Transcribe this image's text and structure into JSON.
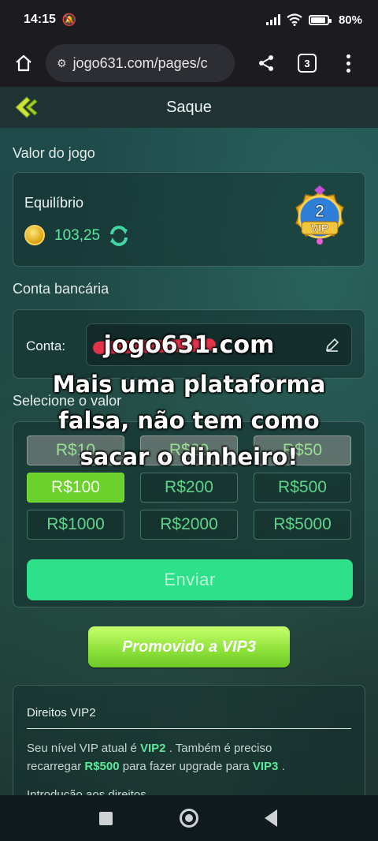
{
  "status_bar": {
    "time": "14:15",
    "battery": "80%"
  },
  "browser": {
    "url": "jogo631.com/pages/c",
    "tab_count": "3"
  },
  "header": {
    "title": "Saque"
  },
  "game_value": {
    "section_label": "Valor do jogo",
    "balance_label": "Equilíbrio",
    "balance_value": "103,25",
    "vip_level": "2",
    "vip_text": "VIP"
  },
  "bank": {
    "section_label": "Conta bancária",
    "field_label": "Conta:"
  },
  "amount": {
    "section_label": "Selecione o valor",
    "options": [
      "R$10",
      "R$20",
      "R$50",
      "R$100",
      "R$200",
      "R$500",
      "R$1000",
      "R$2000",
      "R$5000"
    ],
    "selected": "R$100",
    "submit_label": "Enviar"
  },
  "promo_button": "Promovido a VIP3",
  "rights": {
    "title": "Direitos VIP2",
    "text_1": "Seu nível VIP atual é",
    "current_vip": "VIP2",
    "text_2": ". Também é preciso",
    "text_3": "recarregar",
    "recharge_amount": "R$500",
    "text_4": "para fazer upgrade para",
    "next_vip": "VIP3",
    "text_5": ".",
    "intro": "Introdução aos direitos"
  },
  "overlay_caption": {
    "line_1": "jogo631.com",
    "line_2": "Mais uma plataforma",
    "line_3": "falsa, não tem como",
    "line_4": "sacar o dinheiro!"
  },
  "colors": {
    "accent": "#2de08a",
    "selected": "#6ad12d",
    "highlight": "#5ee89a",
    "redaction": "#e0344a"
  }
}
